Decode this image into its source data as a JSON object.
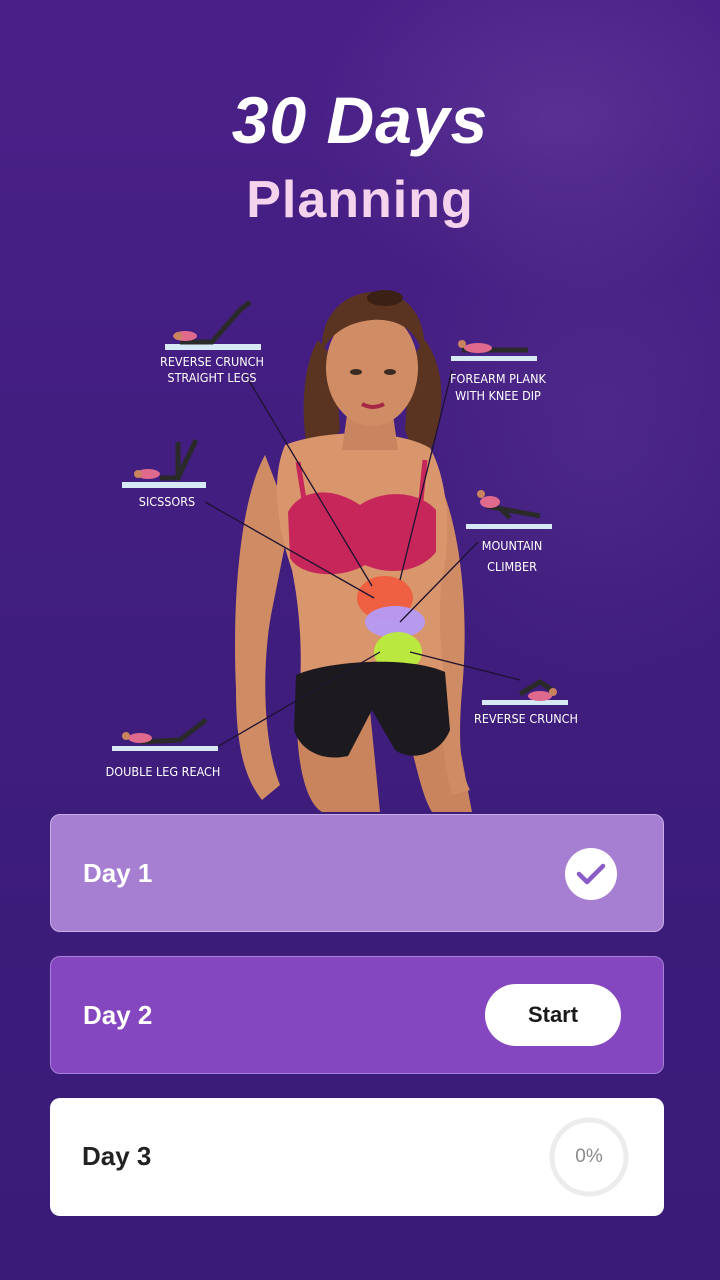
{
  "header": {
    "title": "30 Days",
    "subtitle": "Planning"
  },
  "illustration": {
    "exercises": [
      {
        "label_lines": [
          "REVERSE CRUNCH",
          "STRAIGHT LEGS"
        ]
      },
      {
        "label_lines": [
          "FOREARM PLANK",
          "WITH KNEE DIP"
        ]
      },
      {
        "label_lines": [
          "SICSSORS"
        ]
      },
      {
        "label_lines": [
          "MOUNTAIN",
          "CLIMBER"
        ]
      },
      {
        "label_lines": [
          "REVERSE CRUNCH"
        ]
      },
      {
        "label_lines": [
          "DOUBLE LEG REACH"
        ]
      }
    ]
  },
  "days": [
    {
      "label": "Day 1",
      "state": "completed"
    },
    {
      "label": "Day 2",
      "state": "current",
      "action_label": "Start"
    },
    {
      "label": "Day 3",
      "state": "locked",
      "progress_text": "0%",
      "progress": 0
    }
  ],
  "colors": {
    "background": "#3f1f7a",
    "day1_card": "#a77fd2",
    "day2_card": "#8447bf",
    "check_color": "#8a5cc8",
    "subtitle_color": "#f6d3ec"
  }
}
